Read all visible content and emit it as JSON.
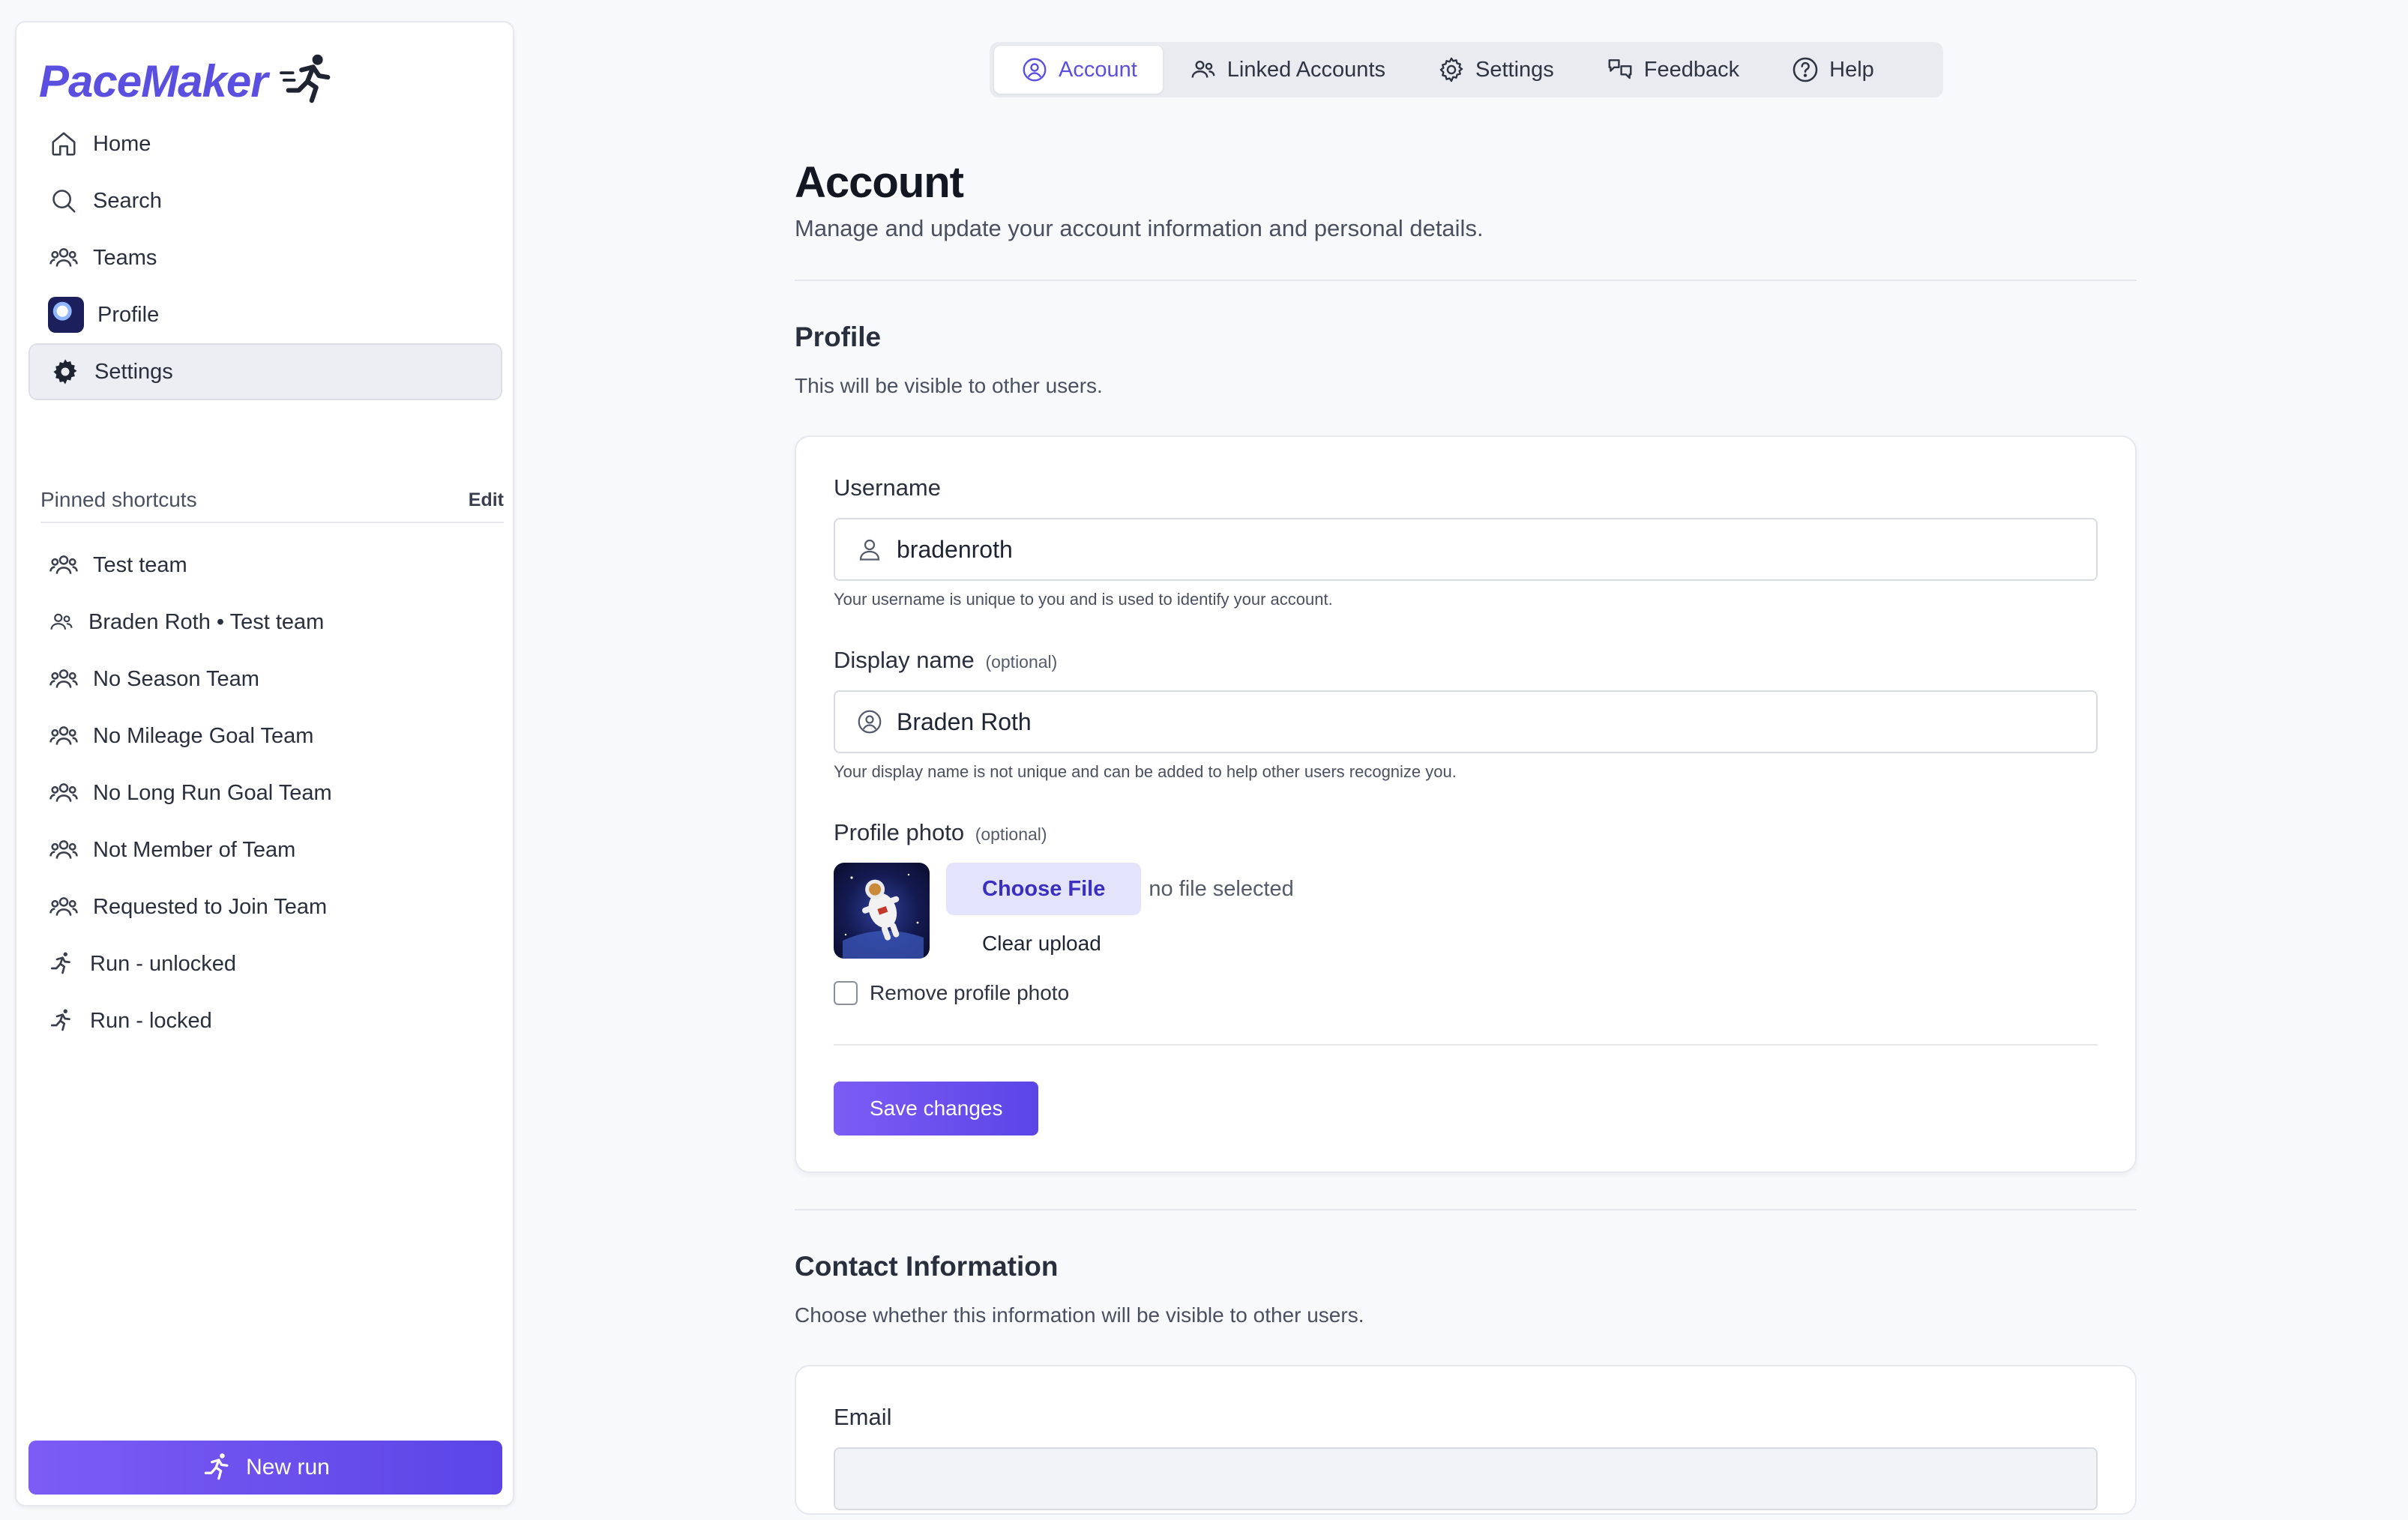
{
  "app": {
    "logo_text": "PaceMaker",
    "colors": {
      "accent": "#5b4fe0",
      "accent_gradient_start": "#7c5cf5",
      "accent_gradient_end": "#5b45e6",
      "active_bg": "#eceef3"
    }
  },
  "sidebar": {
    "nav": [
      {
        "label": "Home",
        "icon": "home-icon"
      },
      {
        "label": "Search",
        "icon": "search-icon"
      },
      {
        "label": "Teams",
        "icon": "users-icon"
      },
      {
        "label": "Profile",
        "icon": "avatar"
      },
      {
        "label": "Settings",
        "icon": "gear-icon",
        "active": true
      }
    ],
    "pinned_title": "Pinned shortcuts",
    "pinned_edit": "Edit",
    "pinned": [
      {
        "label": "Test team",
        "icon": "users-icon"
      },
      {
        "label": "Braden Roth • Test team",
        "icon": "users-icon"
      },
      {
        "label": "No Season Team",
        "icon": "users-icon"
      },
      {
        "label": "No Mileage Goal Team",
        "icon": "users-icon"
      },
      {
        "label": "No Long Run Goal Team",
        "icon": "users-icon"
      },
      {
        "label": "Not Member of Team",
        "icon": "users-icon"
      },
      {
        "label": "Requested to Join Team",
        "icon": "users-icon"
      },
      {
        "label": "Run - unlocked",
        "icon": "runner-icon"
      },
      {
        "label": "Run - locked",
        "icon": "runner-icon"
      }
    ],
    "new_run_label": "New run"
  },
  "tabs": [
    {
      "label": "Account",
      "icon": "user-circle-icon",
      "active": true
    },
    {
      "label": "Linked Accounts",
      "icon": "users-icon"
    },
    {
      "label": "Settings",
      "icon": "gear-icon"
    },
    {
      "label": "Feedback",
      "icon": "feedback-icon"
    },
    {
      "label": "Help",
      "icon": "help-icon"
    }
  ],
  "main": {
    "title": "Account",
    "subtitle": "Manage and update your account information and personal details.",
    "profile": {
      "title": "Profile",
      "description": "This will be visible to other users.",
      "username_label": "Username",
      "username_value": "bradenroth",
      "username_hint": "Your username is unique to you and is used to identify your account.",
      "display_label": "Display name",
      "display_optional": "(optional)",
      "display_value": "Braden Roth",
      "display_hint": "Your display name is not unique and can be added to help other users recognize you.",
      "photo_label": "Profile photo",
      "photo_optional": "(optional)",
      "choose_file": "Choose File",
      "no_file": "no file selected",
      "clear_upload": "Clear upload",
      "remove_photo": "Remove profile photo",
      "save": "Save changes"
    },
    "contact": {
      "title": "Contact Information",
      "description": "Choose whether this information will be visible to other users.",
      "email_label": "Email"
    }
  }
}
